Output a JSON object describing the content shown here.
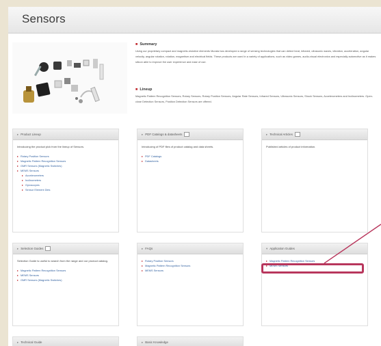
{
  "page": {
    "title": "Sensors"
  },
  "summary": {
    "heading": "Summary",
    "text": "Using our proprietary compact and magnetic-resistive elements Murata has developed a range of sensing technologies that can detect heat, infrared, ultrasonic waves, vibration, acceleration, angular velocity, angular rotation, rotation, magnetism and electrical fields. These products are used in a variety of applications, such as video games, audio-visual electronics and especially automotive as it makes silicon able to improve the user experience and ease of use."
  },
  "lineup": {
    "heading": "Lineup",
    "text": "Magnetic Pattern Recognition Sensors, Rotary Sensors, Rotary Position Sensors, Angular Rate Sensors, Infrared Sensors, Ultrasonic Sensors, Shock Sensors, Accelerometers and Inclinometers. Open-close Detection Sensors, Position Detection Sensors are offered."
  },
  "panels": {
    "product_lineup": {
      "title": "Product Lineup",
      "desc": "Introducing the product pick from the lineup of Sensors.",
      "links": [
        "Rotary Position Sensors",
        "Magnetic Pattern Recognition Sensors",
        "GMR Sensors (Magnetic Switches)",
        "MEMS Sensors"
      ],
      "sublinks": [
        "Accelerometers",
        "Inclinometers",
        "Gyroscopes",
        "Sensor Element Dies"
      ]
    },
    "pdf_catalogs": {
      "title": "PDF Catalogs & datasheets",
      "desc": "Introducing of PDF files of product catalog and data sheets.",
      "links": [
        "PDF Catalogs",
        "Datasheets"
      ]
    },
    "technical_articles": {
      "title": "Technical Articles",
      "desc": "Published articles of product information."
    },
    "selection_guides": {
      "title": "Selection Guides",
      "desc": "Selection Guide is useful to search from the range and our product catalog.",
      "links": [
        "Magnetic Pattern Recognition Sensors",
        "MEMS Sensors",
        "GMR Sensors (Magnetic Switches)"
      ]
    },
    "faq": {
      "title": "FAQs",
      "links": [
        "Rotary Position Sensors",
        "Magnetic Pattern Recognition Sensors",
        "MEMS Sensors"
      ]
    },
    "application_guides": {
      "title": "Application Guides",
      "links": [
        "Magnetic Pattern Recognition Sensors",
        "MEMS Sensors"
      ]
    },
    "technical_guide": {
      "title": "Technical Guide"
    },
    "basic_knowledge": {
      "title": "Basic Knowledge"
    }
  },
  "colors": {
    "accent": "#c0272d",
    "link": "#2f5f9f",
    "highlight": "#b8365c",
    "frame": "#ebe4d2"
  }
}
